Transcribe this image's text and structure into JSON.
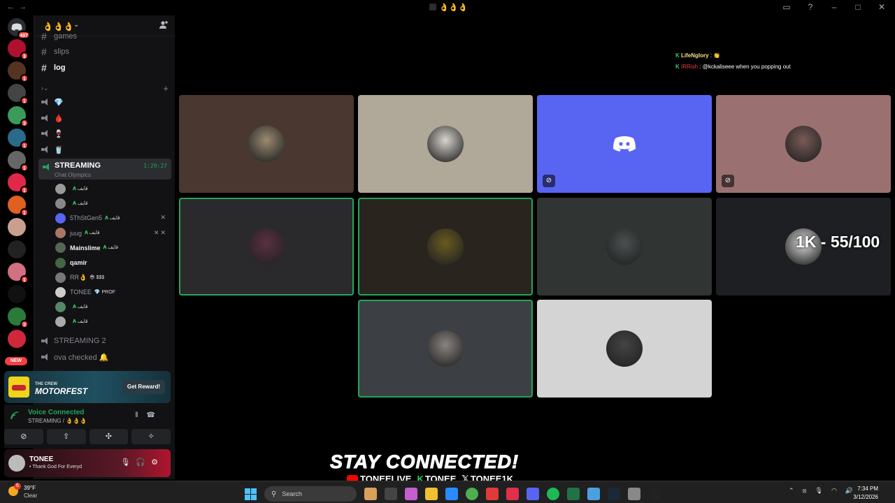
{
  "window": {
    "title": "👌👌👌",
    "nav_back": "←",
    "nav_forward": "→"
  },
  "rail": {
    "home_badge": "497",
    "servers": [
      {
        "color": "#b01030",
        "badge": "3"
      },
      {
        "color": "#553322",
        "badge": "1"
      },
      {
        "color": "#444444",
        "badge": "1"
      },
      {
        "color": "#3a9a5a",
        "badge": "3"
      },
      {
        "color": "#2a6a8a",
        "badge": "1"
      },
      {
        "color": "#666666",
        "badge": "1"
      },
      {
        "color": "#e0284a",
        "badge": "1"
      },
      {
        "color": "#e06020",
        "badge": "1"
      },
      {
        "color": "#c9a090",
        "badge": ""
      },
      {
        "color": "#222222",
        "badge": ""
      },
      {
        "color": "#d07080",
        "badge": "1"
      },
      {
        "color": "#111111",
        "badge": ""
      },
      {
        "color": "#2a7a3a",
        "badge": "3"
      },
      {
        "color": "#d0283a",
        "badge": ""
      }
    ],
    "new_label": "NEW"
  },
  "sidebar": {
    "guild_name": "👌👌👌",
    "channels": [
      {
        "name": "games"
      },
      {
        "name": "slips"
      },
      {
        "name": "log"
      }
    ],
    "voice_channels": [
      {
        "name": "💎"
      },
      {
        "name": "🩸"
      },
      {
        "name": "🍷"
      },
      {
        "name": "🥤"
      }
    ],
    "streaming": {
      "name": "STREAMING",
      "subtitle": "Chat Olympics",
      "timer": "1:29:27"
    },
    "voice_users": [
      {
        "name": "",
        "tag": "قايف",
        "color": "#999999"
      },
      {
        "name": "",
        "tag": "قايف",
        "color": "#888888"
      },
      {
        "name": "5ThStGen5",
        "tag": "قايف",
        "color": "#5865f2",
        "icons": "✕"
      },
      {
        "name": "juug",
        "tag": "قايف",
        "color": "#aa7766",
        "icons": "✕✕"
      },
      {
        "name": "Mainslime",
        "tag": "قايف",
        "color": "#556655",
        "bright": true
      },
      {
        "name": "qamir",
        "tag": "",
        "color": "#446644",
        "bright": true
      },
      {
        "name": "RR👌",
        "tag": "😎 $$$",
        "color": "#777777"
      },
      {
        "name": "TONEE",
        "tag": "💎 PROF",
        "color": "#cccccc"
      },
      {
        "name": "",
        "tag": "قايف",
        "color": "#558866"
      },
      {
        "name": "",
        "tag": "قايف",
        "color": "#aaaaaa"
      }
    ],
    "after_channels": [
      {
        "name": "STREAMING 2"
      },
      {
        "name": "ova checked 🔔"
      }
    ]
  },
  "promo": {
    "game_top": "THE CREW",
    "game_name": "MOTORFEST",
    "button": "Get Reward!"
  },
  "voice_panel": {
    "status": "Voice Connected",
    "location": "STREAMING / 👌👌👌"
  },
  "user_panel": {
    "name": "TONEE",
    "status": "• Thank God For Everyd"
  },
  "chat_overlay": {
    "line0": "LifeNglory : 👏",
    "line1_user": "LifeNglory",
    "line1_msg": ": 👏",
    "line2_user": "IRRish",
    "line2_msg": ": @kckaliseee when you popping out"
  },
  "tiles": [
    {
      "bg": "#4a3830",
      "avatar": "#9a8a70",
      "speaking": false
    },
    {
      "bg": "#b0a898",
      "avatar": "#d8d4cc",
      "speaking": false
    },
    {
      "bg": "#5865f2",
      "avatar": "",
      "speaking": false,
      "discord": true,
      "muted": true
    },
    {
      "bg": "#9a7070",
      "avatar": "#7a5a55",
      "speaking": false,
      "muted": true
    },
    {
      "bg": "#2a2a2c",
      "avatar": "#5a3040",
      "speaking": true
    },
    {
      "bg": "#2a241e",
      "avatar": "#6a5a20",
      "speaking": true
    },
    {
      "bg": "#303432",
      "avatar": "#4a5050",
      "speaking": false
    },
    {
      "bg": "#1e1f22",
      "avatar": "#dddddd",
      "speaking": false
    },
    {
      "bg": "#3c4044",
      "avatar": "#8a8480",
      "speaking": true
    },
    {
      "bg": "#d4d4d4",
      "avatar": "#444444",
      "speaking": false
    }
  ],
  "overlay_count": "1K - 55/100",
  "banner": {
    "title": "STAY CONNECTED!",
    "youtube": "TONEELIVE",
    "kick": "TONEE",
    "x": "TONEE1K"
  },
  "taskbar": {
    "weather_badge": "6",
    "temp": "39°F",
    "condition": "Clear",
    "search_placeholder": "Search",
    "time": "7:34 PM",
    "date": "3/12/2026",
    "apps": [
      "#d9a05a",
      "#444444",
      "#c55fd0",
      "#f0c030",
      "#2a8aff",
      "#4caf50",
      "#e03a3a",
      "#e0304a",
      "#5865f2",
      "#1db954",
      "#217346",
      "#4ca0e0",
      "#1b2838",
      "#888888",
      "#222222"
    ]
  }
}
